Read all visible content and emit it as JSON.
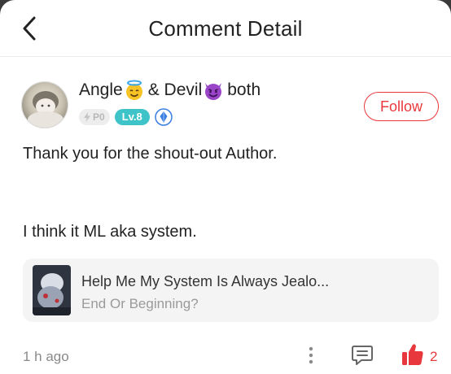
{
  "header": {
    "title": "Comment Detail",
    "back_icon": "chevron-left-icon"
  },
  "user": {
    "name_part1": "Angle",
    "name_part2": "& Devil",
    "name_part3": "both",
    "emoji1": "smiling-face-with-halo",
    "emoji2": "smiling-face-with-horns",
    "power_badge": "P0",
    "level_badge": "Lv.8",
    "verified_icon": "diamond-badge-icon"
  },
  "follow_label": "Follow",
  "comment": {
    "line1": "Thank you for the shout-out Author.",
    "line2": "I think it ML aka system."
  },
  "book": {
    "title": "Help Me My System Is Always Jealo...",
    "chapter": "End Or Beginning?"
  },
  "footer": {
    "time": "1 h ago",
    "like_count": "2"
  },
  "colors": {
    "accent": "#e8383d",
    "level_badge": "#3ec4c8",
    "verified": "#3b7de0"
  }
}
